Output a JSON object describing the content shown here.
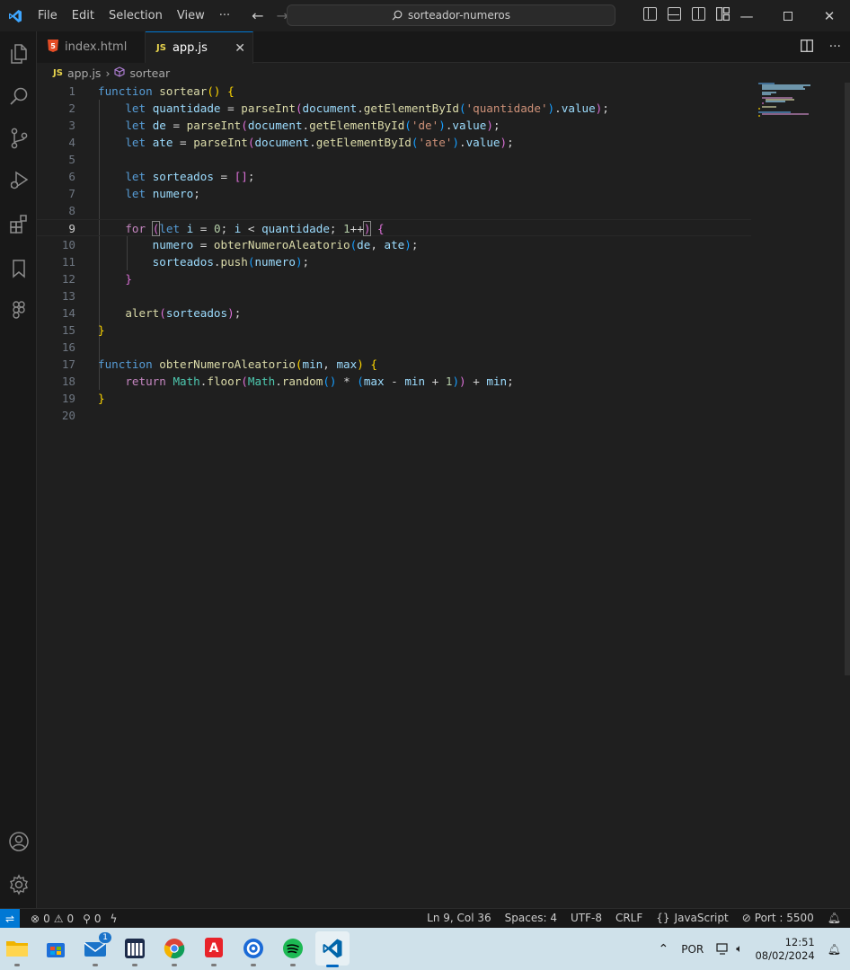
{
  "titlebar": {
    "menu": [
      "File",
      "Edit",
      "Selection",
      "View",
      "···"
    ],
    "search_text": "sorteador-numeros"
  },
  "tabs": [
    {
      "label": "index.html",
      "icon": "html5-icon"
    },
    {
      "label": "app.js",
      "icon": "js-icon",
      "active": true
    }
  ],
  "breadcrumb": {
    "file": "app.js",
    "symbol": "sortear",
    "file_icon_text": "JS"
  },
  "editor": {
    "line_numbers": [
      "1",
      "2",
      "3",
      "4",
      "5",
      "6",
      "7",
      "8",
      "9",
      "10",
      "11",
      "12",
      "13",
      "14",
      "15",
      "16",
      "17",
      "18",
      "19",
      "20"
    ],
    "current_line": 9
  },
  "statusbar": {
    "errors": "0",
    "warnings": "0",
    "ports": "0",
    "position": "Ln 9, Col 36",
    "spaces": "Spaces: 4",
    "encoding": "UTF-8",
    "eol": "CRLF",
    "language": "JavaScript",
    "port": "Port : 5500"
  },
  "taskbar": {
    "mail_badge": "1",
    "tray_lang": "POR",
    "time": "12:51",
    "date": "08/02/2024"
  },
  "colors": {
    "accent": "#0078d4",
    "background": "#1f1f1f",
    "taskbar": "#cfe1ea"
  }
}
